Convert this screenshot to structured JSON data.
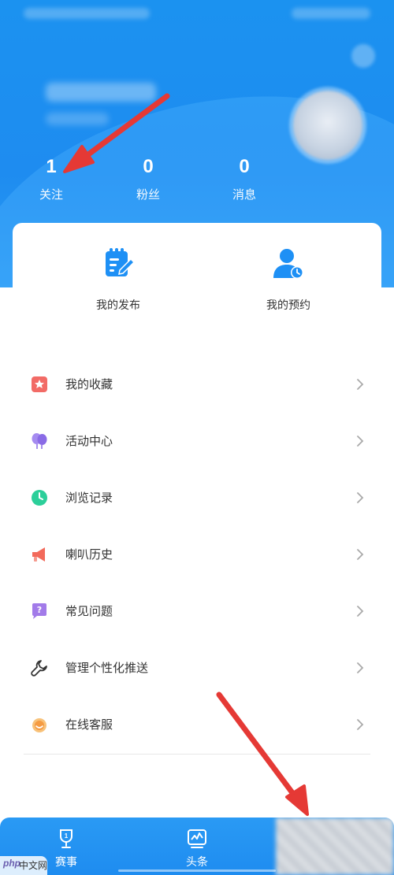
{
  "header": {
    "stats": [
      {
        "value": "1",
        "label": "关注"
      },
      {
        "value": "0",
        "label": "粉丝"
      },
      {
        "value": "0",
        "label": "消息"
      }
    ]
  },
  "quick_actions": [
    {
      "label": "我的发布",
      "icon": "edit-note-icon"
    },
    {
      "label": "我的预约",
      "icon": "reservation-user-icon"
    }
  ],
  "menu": {
    "items": [
      {
        "label": "我的收藏",
        "icon": "bookmark-star-icon",
        "color": "#f0635f"
      },
      {
        "label": "活动中心",
        "icon": "balloons-icon",
        "color": "#9b7be8"
      },
      {
        "label": "浏览记录",
        "icon": "clock-icon",
        "color": "#2ccf9a"
      },
      {
        "label": "喇叭历史",
        "icon": "megaphone-icon",
        "color": "#f26a5b"
      },
      {
        "label": "常见问题",
        "icon": "question-icon",
        "color": "#a27be9"
      },
      {
        "label": "管理个性化推送",
        "icon": "wrench-icon",
        "color": "#333333"
      },
      {
        "label": "在线客服",
        "icon": "customer-service-icon",
        "color": "#f59b42"
      }
    ]
  },
  "bottom_nav": {
    "items": [
      {
        "label": "赛事",
        "icon": "trophy-icon"
      },
      {
        "label": "头条",
        "icon": "headline-icon"
      }
    ]
  },
  "watermark": {
    "brand": "php",
    "text": "中文网"
  },
  "colors": {
    "primary_blue": "#1e8cf0",
    "annotation_red": "#e53935"
  }
}
